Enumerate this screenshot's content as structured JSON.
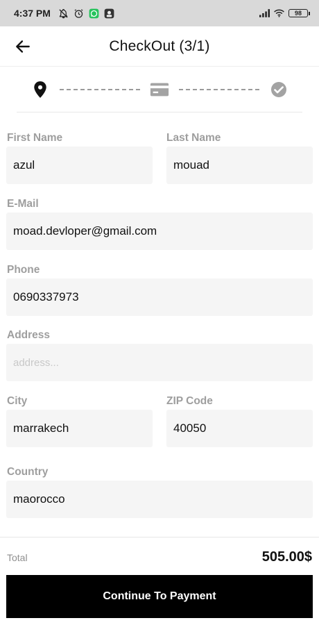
{
  "status_bar": {
    "time": "4:37 PM",
    "battery": "98",
    "icons": [
      "notifications-off-icon",
      "alarm-icon",
      "whatsapp-icon",
      "app-notification-icon",
      "signal-icon",
      "wifi-icon",
      "battery-icon"
    ]
  },
  "header": {
    "title": "CheckOut (3/1)",
    "back_icon": "arrow-left-icon"
  },
  "stepper": {
    "steps": [
      {
        "icon": "location-pin-icon",
        "state": "active"
      },
      {
        "icon": "credit-card-icon",
        "state": "inactive"
      },
      {
        "icon": "check-circle-icon",
        "state": "inactive"
      }
    ],
    "colors": {
      "active": "#111111",
      "inactive": "#a3a3a3"
    }
  },
  "form": {
    "first_name": {
      "label": "First Name",
      "value": "azul"
    },
    "last_name": {
      "label": "Last Name",
      "value": "mouad"
    },
    "email": {
      "label": "E-Mail",
      "value": "moad.devloper@gmail.com"
    },
    "phone": {
      "label": "Phone",
      "value": "0690337973"
    },
    "address": {
      "label": "Address",
      "value": "",
      "placeholder": "address..."
    },
    "city": {
      "label": "City",
      "value": "marrakech"
    },
    "zip": {
      "label": "ZIP Code",
      "value": "40050"
    },
    "country": {
      "label": "Country",
      "value": "maorocco"
    }
  },
  "summary": {
    "total_label": "Total",
    "total_value": "505.00$"
  },
  "actions": {
    "continue_label": "Continue To Payment"
  },
  "colors": {
    "button_bg": "#000000",
    "input_bg": "#f5f5f5",
    "label": "#9e9e9e"
  }
}
